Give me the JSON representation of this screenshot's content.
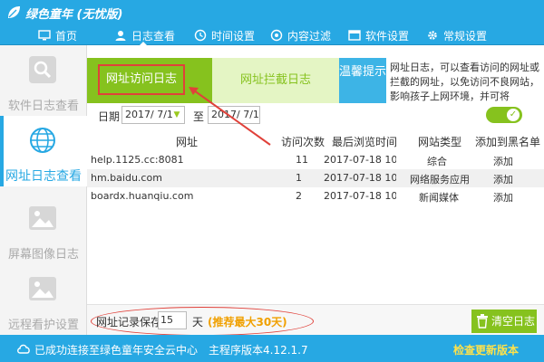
{
  "app": {
    "title": "绿色童年 (无忧版)"
  },
  "nav": {
    "items": [
      {
        "label": "首页",
        "icon": "monitor-icon"
      },
      {
        "label": "日志查看",
        "icon": "user-icon",
        "active": true
      },
      {
        "label": "时间设置",
        "icon": "clock-icon"
      },
      {
        "label": "内容过滤",
        "icon": "filter-icon"
      },
      {
        "label": "软件设置",
        "icon": "software-icon"
      },
      {
        "label": "常规设置",
        "icon": "gear-icon"
      }
    ]
  },
  "sidebar": {
    "items": [
      {
        "label": "软件日志查看",
        "icon": "search-icon"
      },
      {
        "label": "网址日志查看",
        "icon": "globe-icon",
        "active": true
      },
      {
        "label": "屏幕图像日志",
        "icon": "image-icon"
      },
      {
        "label": "远程看护设置",
        "icon": "image-icon"
      }
    ]
  },
  "tabs": {
    "visit_log": "网址访问日志",
    "block_log": "网址拦截日志",
    "tip_label": "温馨提示",
    "tip_text": "网址日志，可以查看访问的网址或拦截的网址，以免访问不良网站，影响孩子上网环境，并可将"
  },
  "filter": {
    "date_label": "日期",
    "date_from": "2017/ 7/1",
    "to_label": "至",
    "date_to": "2017/ 7/1"
  },
  "table": {
    "headers": [
      "网址",
      "访问次数",
      "最后浏览时间",
      "网站类型",
      "添加到黑名单"
    ],
    "rows": [
      {
        "url": "help.1125.cc:8081",
        "count": "11",
        "time": "2017-07-18 10:...",
        "type": "综合",
        "action": "添加"
      },
      {
        "url": "hm.baidu.com",
        "count": "1",
        "time": "2017-07-18 10:...",
        "type": "网络服务应用",
        "action": "添加"
      },
      {
        "url": "boardx.huanqiu.com",
        "count": "2",
        "time": "2017-07-18 10:...",
        "type": "新闻媒体",
        "action": "添加"
      }
    ]
  },
  "retention": {
    "label": "网址记录保存",
    "value": "15",
    "unit": "天",
    "note": "(推荐最大30天)"
  },
  "clear_button": "清空日志",
  "status": {
    "connection": "已成功连接至绿色童年安全云中心",
    "version": "主程序版本4.12.1.7",
    "update": "检查更新版本"
  },
  "colors": {
    "brand_blue": "#27a8e3",
    "accent_green": "#86c21e",
    "annotation_red": "#e0413a"
  }
}
